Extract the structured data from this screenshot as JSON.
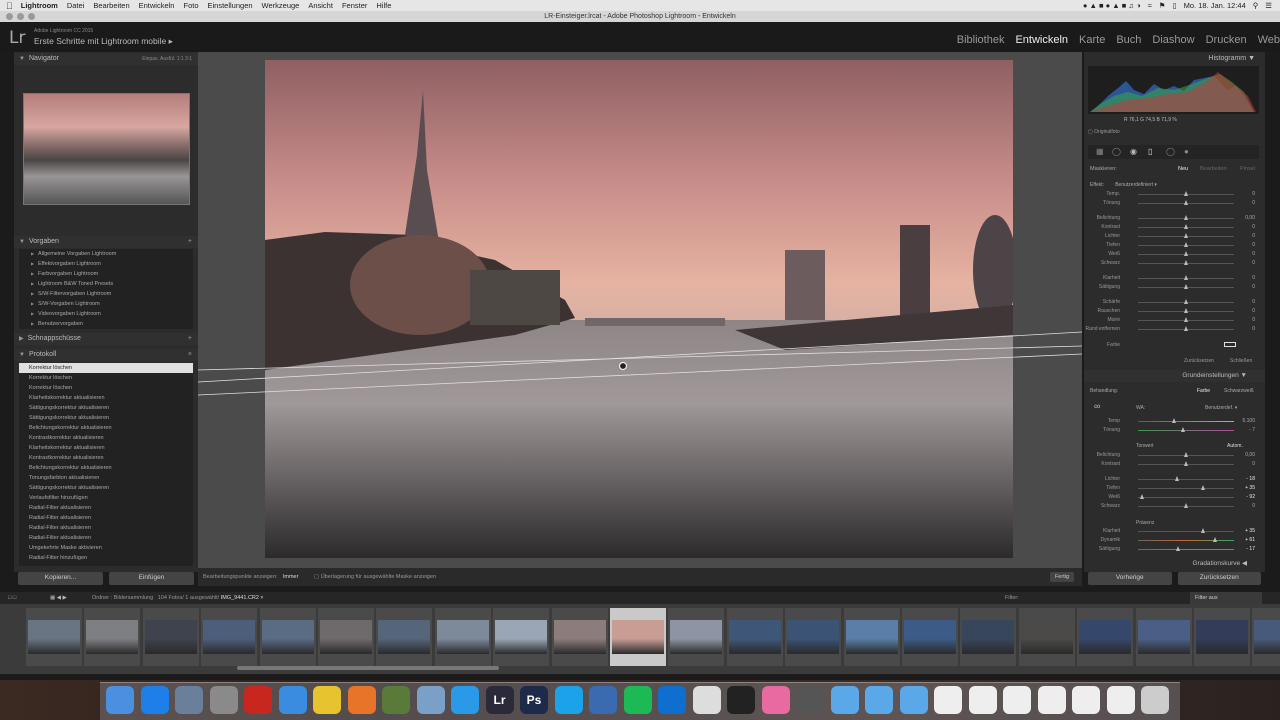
{
  "mac_menu": {
    "app": "Lightroom",
    "items": [
      "Datei",
      "Bearbeiten",
      "Entwickeln",
      "Foto",
      "Einstellungen",
      "Werkzeuge",
      "Ansicht",
      "Fenster",
      "Hilfe"
    ],
    "clock": "Mo. 18. Jan.  12:44"
  },
  "window": {
    "title": "LR-Einsteiger.lrcat - Adobe Photoshop Lightroom - Entwickeln"
  },
  "identity": {
    "logo": "Lr",
    "product": "Adobe Lightroom CC 2015",
    "subtitle": "Erste Schritte mit Lightroom mobile"
  },
  "modules": {
    "m1": "Bibliothek",
    "m2": "Entwickeln",
    "m3": "Karte",
    "m4": "Buch",
    "m5": "Diashow",
    "m6": "Drucken",
    "m7": "Web"
  },
  "left": {
    "navigator": "Navigator",
    "nav_modes": "Einpas.   Ausfül.   1:1   3:1",
    "presets_title": "Vorgaben",
    "presets": [
      "Allgemeine Vorgaben Lightroom",
      "Effektvorgaben Lightroom",
      "Farbvorgaben Lightroom",
      "Lightroom B&W Toned Presets",
      "S/W-Filtervorgaben Lightroom",
      "S/W-Vorgaben Lightroom",
      "Videovorgaben Lightroom",
      "Benutzervorgaben"
    ],
    "snapshots_title": "Schnappschüsse",
    "history_title": "Protokoll",
    "history": [
      "Korrektur löschen",
      "Korrektur löschen",
      "Korrektur löschen",
      "Klarheitskorrektur aktualisieren",
      "Sättigungskorrektur aktualisieren",
      "Sättigungskorrektur aktualisieren",
      "Belichtungskorrektur aktualisieren",
      "Kontrastkorrektur aktualisieren",
      "Klarheitskorrektur aktualisieren",
      "Kontrastkorrektur aktualisieren",
      "Belichtungskorrektur aktualisieren",
      "Tonungsfarbton aktualisieren",
      "Sättigungskorrektur aktualisieren",
      "Verlaufsfilter hinzufügen",
      "Radial-Filter aktualisieren",
      "Radial-Filter aktualisieren",
      "Radial-Filter aktualisieren",
      "Radial-Filter aktualisieren",
      "Umgekehrte Maske aktivieren",
      "Radial-Filter hinzufügen"
    ],
    "copy_btn": "Kopieren...",
    "paste_btn": "Einfügen"
  },
  "toolbar": {
    "label": "Bearbeitungspunkte anzeigen:",
    "value": "Immer",
    "overlay": "Überlagerung für ausgewählte Maske anzeigen",
    "done": "Fertig"
  },
  "right": {
    "histogram_title": "Histogramm",
    "rgb": "R  76,1  G  74,5  B  71,9  %",
    "original_photo": "Originalfoto",
    "mask_label": "Maskieren:",
    "mask_new": "Neu",
    "mask_edit": "Bearbeiten",
    "mask_brush": "Pinsel",
    "effect_label": "Effekt:",
    "effect_value": "Benutzerdefiniert",
    "mask_sliders": [
      {
        "label": "Temp.",
        "value": "0",
        "pos": 0.5
      },
      {
        "label": "Tönung",
        "value": "0",
        "pos": 0.5
      },
      {
        "label": "Belichtung",
        "value": "0,00",
        "pos": 0.5
      },
      {
        "label": "Kontrast",
        "value": "0",
        "pos": 0.5
      },
      {
        "label": "Lichter",
        "value": "0",
        "pos": 0.5
      },
      {
        "label": "Tiefen",
        "value": "0",
        "pos": 0.5
      },
      {
        "label": "Weiß",
        "value": "0",
        "pos": 0.5
      },
      {
        "label": "Schwarz",
        "value": "0",
        "pos": 0.5
      },
      {
        "label": "Klarheit",
        "value": "0",
        "pos": 0.5
      },
      {
        "label": "Sättigung",
        "value": "0",
        "pos": 0.5
      },
      {
        "label": "Schärfe",
        "value": "0",
        "pos": 0.5
      },
      {
        "label": "Rauschen",
        "value": "0",
        "pos": 0.5
      },
      {
        "label": "Moiré",
        "value": "0",
        "pos": 0.5
      },
      {
        "label": "Rand entfernen",
        "value": "0",
        "pos": 0.5
      }
    ],
    "color_label": "Farbe",
    "reset": "Zurücksetzen",
    "close": "Schließen",
    "basic_title": "Grundeinstellungen",
    "treatment": "Behandlung:",
    "color_mode": "Farbe",
    "bw_mode": "Schwarzweiß",
    "wb_label": "WA:",
    "wb_value": "Benutzerdef.",
    "wb_sliders": [
      {
        "label": "Temp",
        "value": "5.100",
        "pos": 0.38
      },
      {
        "label": "Tönung",
        "value": "- 7",
        "pos": 0.47
      }
    ],
    "tone_label": "Tonwert",
    "auto": "Autom.",
    "tone_sliders": [
      {
        "label": "Belichtung",
        "value": "0,00",
        "pos": 0.5
      },
      {
        "label": "Kontrast",
        "value": "0",
        "pos": 0.5
      }
    ],
    "tone2_sliders": [
      {
        "label": "Lichter",
        "value": "- 18",
        "pos": 0.41
      },
      {
        "label": "Tiefen",
        "value": "+ 35",
        "pos": 0.68
      },
      {
        "label": "Weiß",
        "value": "- 92",
        "pos": 0.04
      },
      {
        "label": "Schwarz",
        "value": "0",
        "pos": 0.5
      }
    ],
    "presence_label": "Präsenz",
    "presence_sliders": [
      {
        "label": "Klarheit",
        "value": "+ 35",
        "pos": 0.68
      },
      {
        "label": "Dynamik",
        "value": "+ 61",
        "pos": 0.8
      },
      {
        "label": "Sättigung",
        "value": "- 17",
        "pos": 0.42
      }
    ],
    "curve_title": "Gradationskurve",
    "prev_btn": "Vorherige",
    "reset_btn": "Zurücksetzen"
  },
  "filmbar": {
    "source": "Ordner : Bildersammlung",
    "count": "104 Fotos/ 1 ausgewählt/",
    "file": "IMG_9441.CR2",
    "filter_label": "Filter:",
    "filter_value": "Filter aus"
  },
  "filmstrip": {
    "selected_index": 10,
    "colors": [
      "#6a7583",
      "#7d7f83",
      "#3f434e",
      "#4d5e7a",
      "#5a6b84",
      "#6e6a6c",
      "#55657a",
      "#7c8a9a",
      "#9aa6b5",
      "#8c7c7c",
      "#c79d94",
      "#8d95a5",
      "#3e5778",
      "#3b5375",
      "#5a7ea8",
      "#3c5b86",
      "#38465c",
      "#4c4a48",
      "#35476a",
      "#4b5f86",
      "#333c58",
      "#485a7b"
    ]
  },
  "dock": {
    "apps": [
      "Finder",
      "App Store",
      "Vorschau",
      "Systemeinstellungen",
      "FileZilla",
      "Mail",
      "Chrome",
      "Firefox",
      "Sublime",
      "iPhoto",
      "Safari",
      "Lr",
      "Ps",
      "Skype",
      "Tastatur",
      "Spotify",
      "TeamViewer",
      "Kalender",
      "Steam",
      "Fotos",
      "Video",
      "Ordner",
      "Ordner",
      "Ordner",
      "Dokument",
      "Dokument",
      "Dokument",
      "Dokument",
      "Dokument",
      "Dokument",
      "Papierkorb"
    ]
  }
}
